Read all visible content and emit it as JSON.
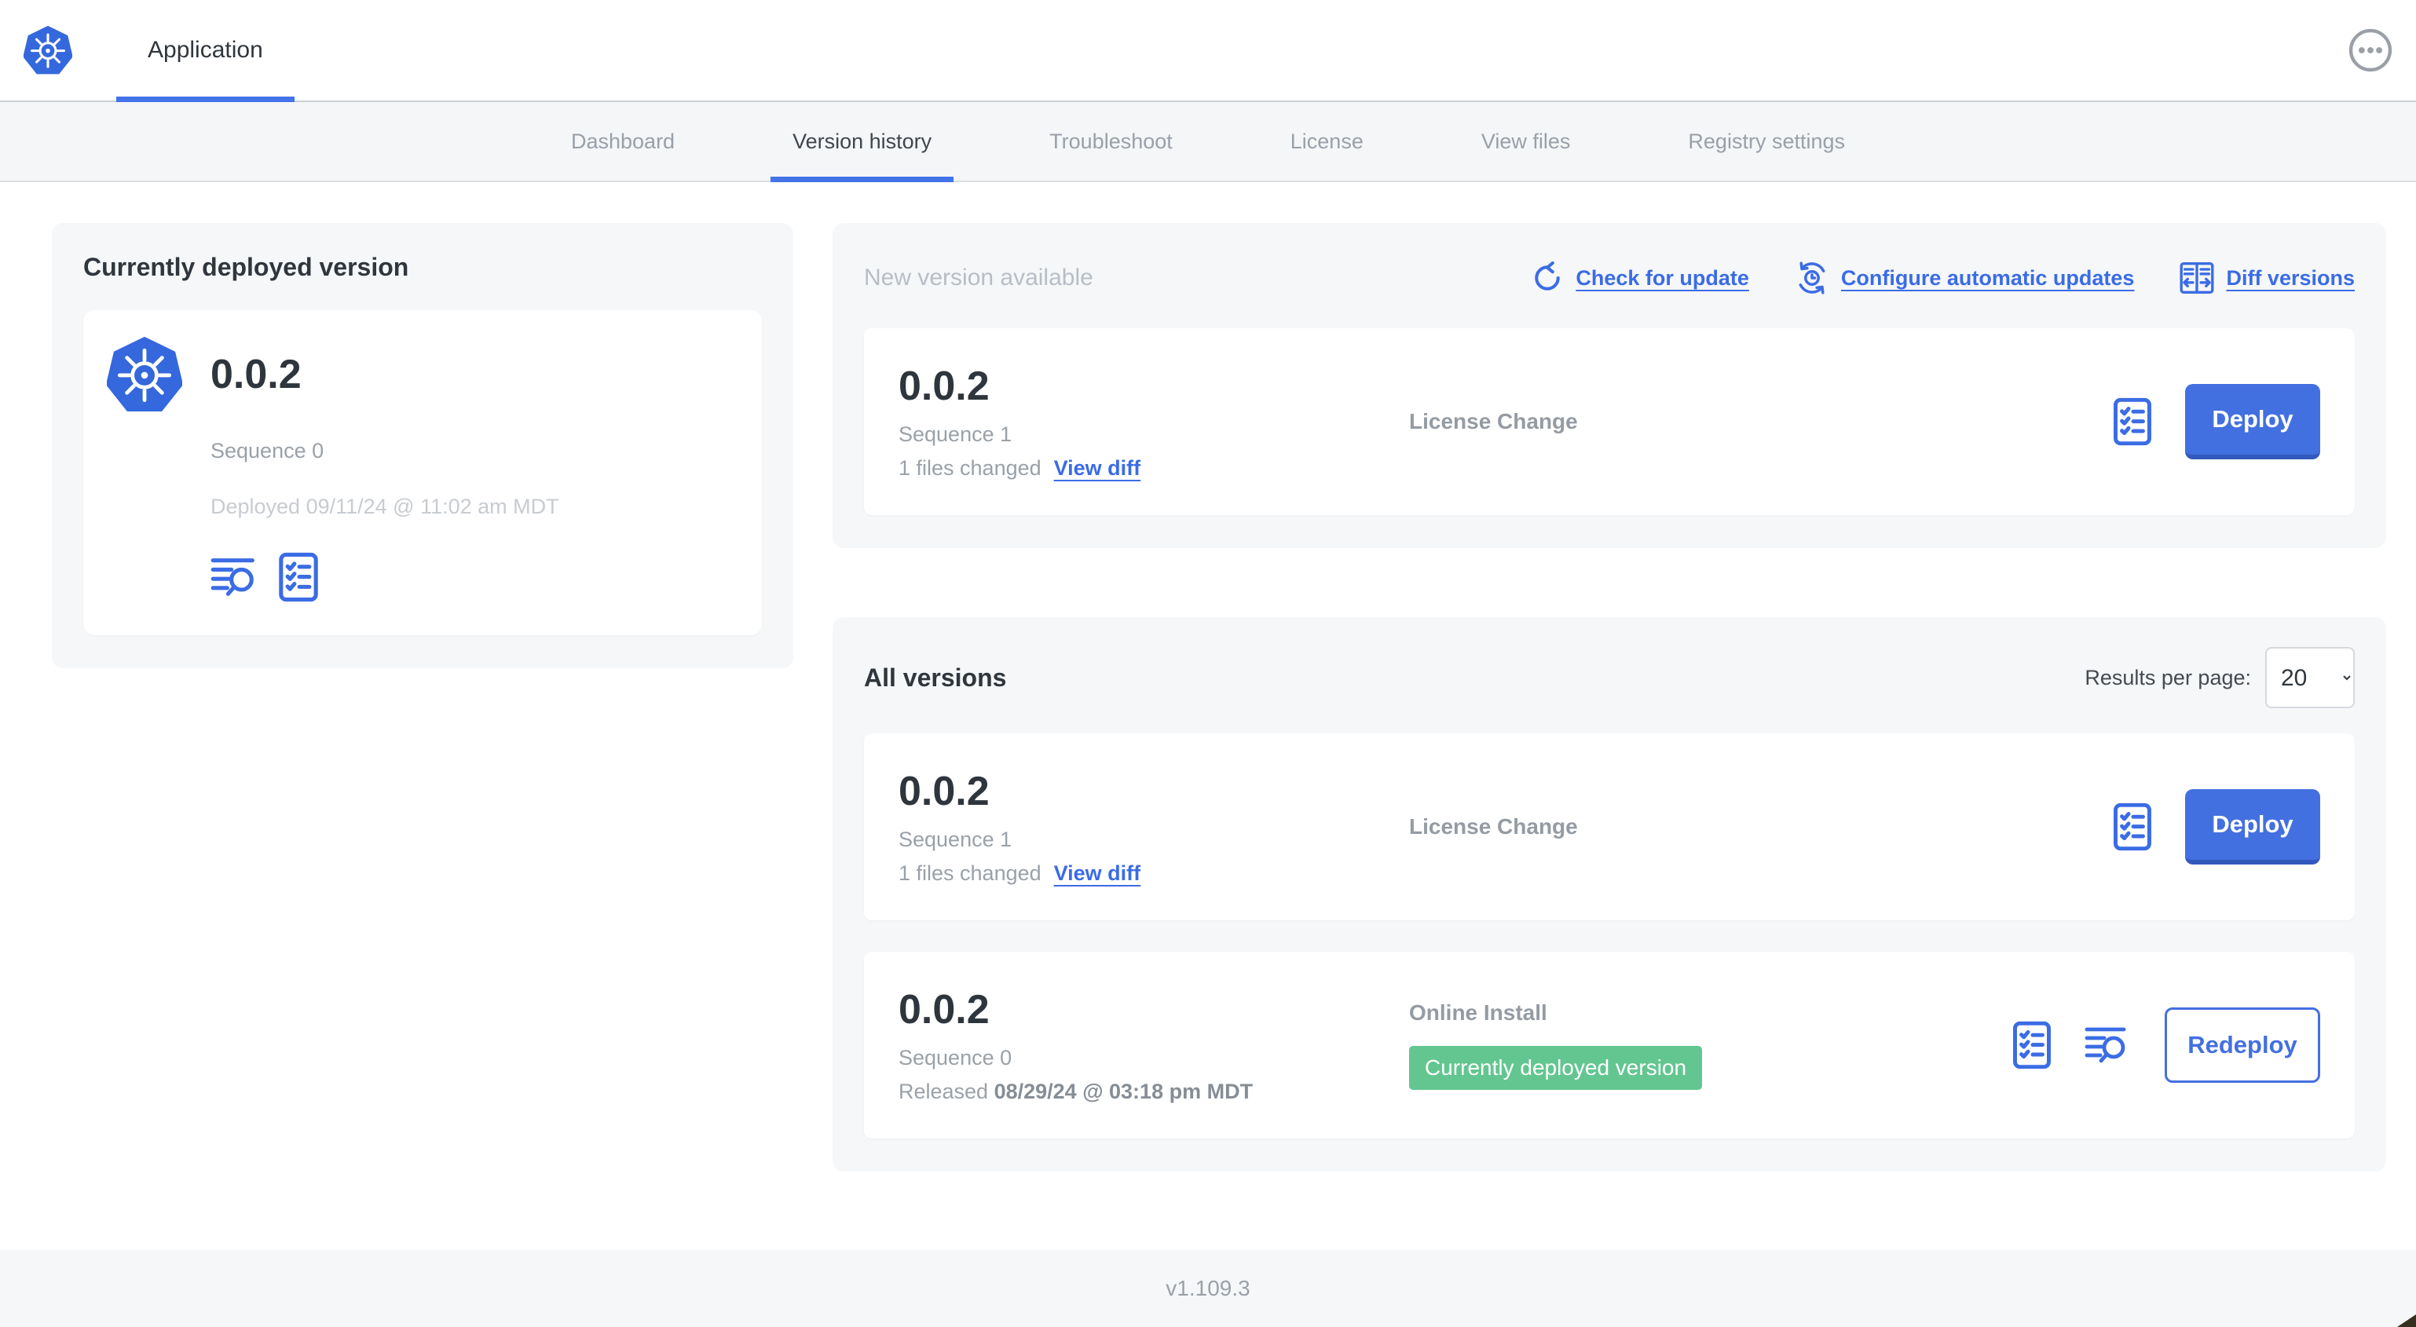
{
  "header": {
    "app_name": "Application"
  },
  "nav": {
    "tabs": [
      {
        "label": "Dashboard"
      },
      {
        "label": "Version history"
      },
      {
        "label": "Troubleshoot"
      },
      {
        "label": "License"
      },
      {
        "label": "View files"
      },
      {
        "label": "Registry settings"
      }
    ]
  },
  "current_card": {
    "title": "Currently deployed version",
    "version": "0.0.2",
    "sequence": "Sequence 0",
    "deployed": "Deployed 09/11/24 @ 11:02 am MDT"
  },
  "new_version_card": {
    "title": "New version available",
    "check_for_update": "Check for update",
    "configure_updates": "Configure automatic updates",
    "diff_versions": "Diff versions",
    "row": {
      "version": "0.0.2",
      "sequence": "Sequence 1",
      "files_changed": "1 files changed",
      "view_diff": "View diff",
      "source": "License Change",
      "deploy": "Deploy"
    }
  },
  "all_versions_card": {
    "title": "All versions",
    "results_label": "Results per page:",
    "results_value": "20",
    "row1": {
      "version": "0.0.2",
      "sequence": "Sequence 1",
      "files_changed": "1 files changed",
      "view_diff": "View diff",
      "source": "License Change",
      "deploy": "Deploy"
    },
    "row2": {
      "version": "0.0.2",
      "sequence": "Sequence 0",
      "released_label": "Released",
      "released_date": "08/29/24 @ 03:18 pm MDT",
      "source": "Online Install",
      "badge": "Currently deployed version",
      "redeploy": "Redeploy"
    }
  },
  "footer": {
    "app_version": "v1.109.3"
  },
  "colors": {
    "primary_blue": "#3b6ce5",
    "button_blue": "#4370e0",
    "badge_green": "#63c690",
    "k8s_blue": "#3568dd",
    "card_bg": "#f5f7f9"
  }
}
